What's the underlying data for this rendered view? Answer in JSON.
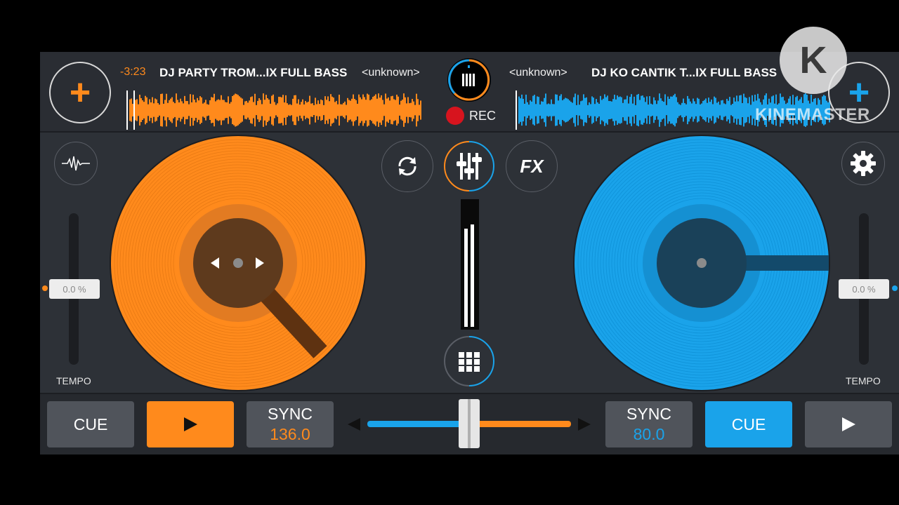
{
  "deck_left": {
    "time": "-3:23",
    "title": "DJ PARTY TROM...IX FULL BASS",
    "artist": "<unknown>",
    "tempo_value": "0.0 %",
    "tempo_label": "TEMPO",
    "cue_label": "CUE",
    "sync_label": "SYNC",
    "bpm": "136.0",
    "color": "#ff8a1c"
  },
  "deck_right": {
    "artist": "<unknown>",
    "title": "DJ KO CANTIK T...IX FULL BASS",
    "tempo_value": "0.0 %",
    "tempo_label": "TEMPO",
    "cue_label": "CUE",
    "sync_label": "SYNC",
    "bpm": "80.0",
    "color": "#1aa3ea"
  },
  "center": {
    "rec_label": "REC",
    "fx_label": "FX"
  },
  "watermark": {
    "text": "KINEMASTER",
    "logo_letter": "K"
  }
}
